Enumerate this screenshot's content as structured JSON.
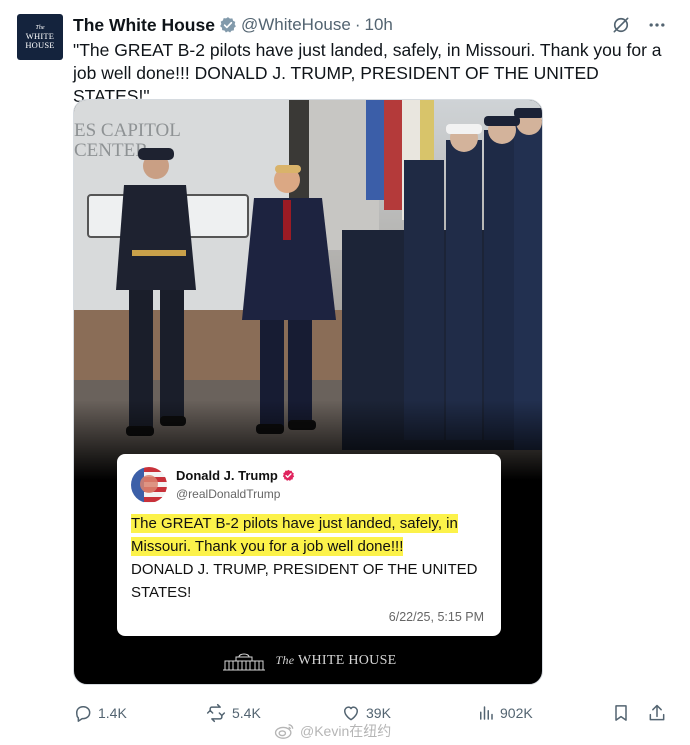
{
  "account": {
    "avatar_small": "The",
    "avatar_line1": "WHITE",
    "avatar_line2": "HOUSE",
    "name": "The White House",
    "handle": "@WhiteHouse",
    "separator": "·",
    "time": "10h",
    "verified_color": "#829aab"
  },
  "tweet": {
    "text": "\"The GREAT B-2 pilots have just landed, safely, in Missouri. Thank you for a job well done!!! DONALD J. TRUMP, PRESIDENT OF THE UNITED STATES!\""
  },
  "quote": {
    "name": "Donald J. Trump",
    "handle": "@realDonaldTrump",
    "highlight_text": "The GREAT B-2 pilots have just landed, safely, in Missouri. Thank you for a job well done!!!",
    "body_rest": "DONALD J. TRUMP, PRESIDENT OF THE UNITED STATES!",
    "date": "6/22/25, 5:15 PM",
    "highlight_color": "#fcf24a",
    "badge_color": "#e0245e"
  },
  "photo": {
    "wall_sign_line1": "ES CAPITOL",
    "wall_sign_line2": "CENTER"
  },
  "brand_footer": {
    "the": "The",
    "name": "WHITE HOUSE"
  },
  "metrics": {
    "replies": "1.4K",
    "reposts": "5.4K",
    "likes": "39K",
    "views": "902K"
  },
  "watermark": "@Kevin在纽约",
  "icons": {
    "grok": "grok-icon",
    "more": "more-icon",
    "reply": "reply-icon",
    "repost": "repost-icon",
    "like": "like-icon",
    "views": "views-icon",
    "bookmark": "bookmark-icon",
    "share": "share-icon"
  }
}
